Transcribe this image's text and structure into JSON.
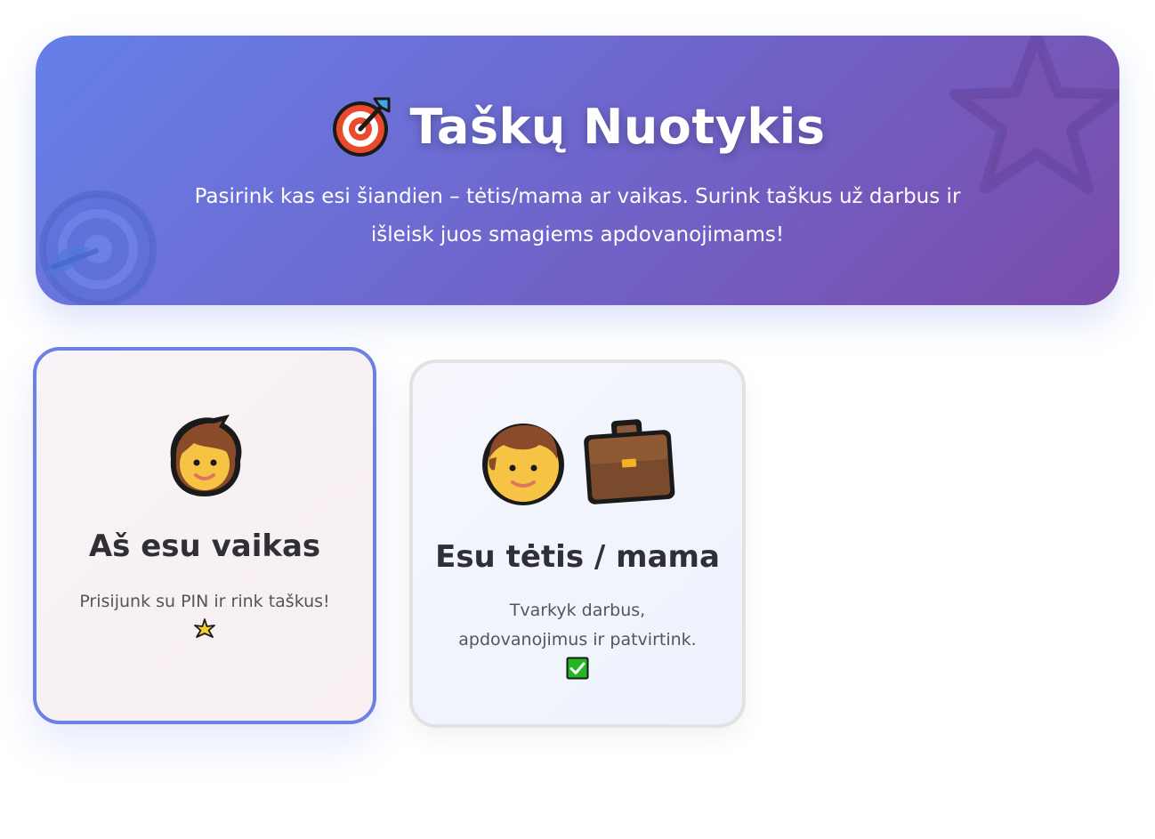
{
  "header": {
    "title": "Taškų Nuotykis",
    "title_icon": "target-dart-icon",
    "subtitle": "Pasirink kas esi šiandien – tėtis/mama ar vaikas. Surink taškus už darbus ir išleisk juos smagiems apdovanojimams!",
    "gradient_start": "#6580e9",
    "gradient_end": "#7a4ba9"
  },
  "roles": [
    {
      "id": "child",
      "title": "Aš esu vaikas",
      "description": "Prisijunk su PIN ir rink taškus!",
      "icons": [
        "child-face-icon"
      ],
      "desc_icon": "sparkle-star-icon",
      "selected": true,
      "border_color": "#6c80e6"
    },
    {
      "id": "parent",
      "title": "Esu tėtis / mama",
      "description": "Tvarkyk darbus, apdovanojimus ir patvirtink.",
      "icons": [
        "adult-face-icon",
        "briefcase-icon"
      ],
      "desc_icon": "check-mark-icon",
      "selected": false,
      "border_color": "#e2e2e2"
    }
  ]
}
